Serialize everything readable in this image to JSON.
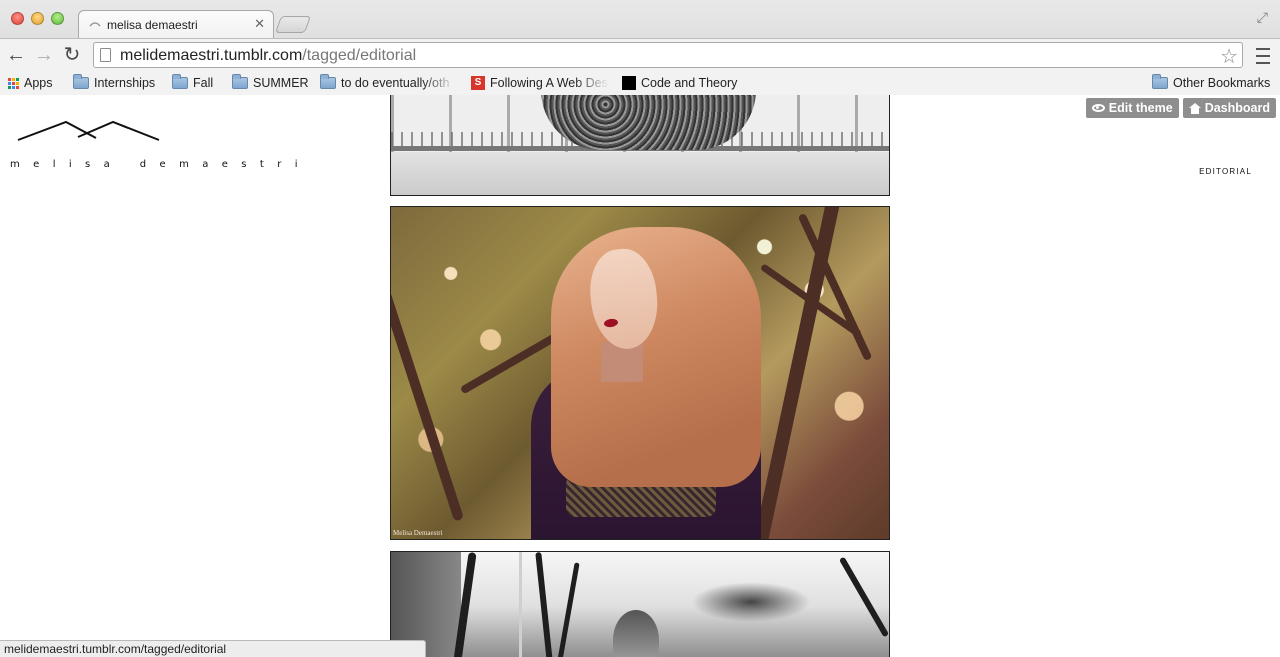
{
  "browser": {
    "tab_title": "melisa demaestri",
    "url_domain": "melidemaestri.tumblr.com",
    "url_path": "/tagged/editorial",
    "status_url": "melidemaestri.tumblr.com/tagged/editorial"
  },
  "bookmarks": {
    "items": [
      {
        "label": "Apps",
        "icon": "apps-grid-icon"
      },
      {
        "label": "Internships",
        "icon": "folder-icon"
      },
      {
        "label": "Fall",
        "icon": "folder-icon"
      },
      {
        "label": "SUMMER",
        "icon": "folder-icon"
      },
      {
        "label": "to do eventually/oth",
        "icon": "folder-icon"
      },
      {
        "label": "Following A Web Des",
        "icon": "site-favicon"
      },
      {
        "label": "Code and Theory",
        "icon": "site-favicon"
      }
    ],
    "other": "Other Bookmarks"
  },
  "site": {
    "name": "melisa demaestri",
    "tag_heading": "EDITORIAL",
    "edit_theme": "Edit theme",
    "dashboard": "Dashboard",
    "photo_watermark": "Melisa Demaestri"
  },
  "colors": {
    "accent_button": "#8e8e8e",
    "bookmark_red": "#d9362b"
  }
}
